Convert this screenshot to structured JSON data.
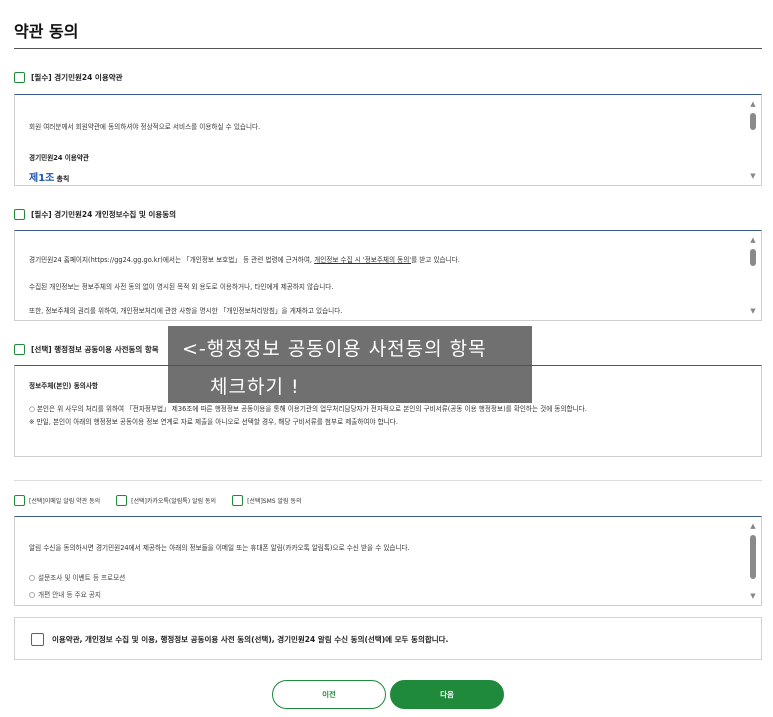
{
  "page": {
    "title": "약관 동의"
  },
  "section1": {
    "label": "[필수] 경기민원24 이용약관",
    "intro": "회원 여러분께서 회원약관에 동의하셔야 정상적으로 서비스를 이용하실 수 있습니다.",
    "heading": "경기민원24 이용약관",
    "article_num": "제1조",
    "article_title": "총칙"
  },
  "section2": {
    "label": "[필수] 경기민원24 개인정보수집 및 이용동의",
    "line1_a": "경기민원24 홈페이지(https://gg24.gg.go.kr)에서는 「개인정보 보호법」 등 관련 법령에 근거하여, ",
    "line1_b": "개인정보 수집 시 '정보주체의 동의'",
    "line1_c": "를 받고 있습니다.",
    "line2": "수집된 개인정보는 정보주체의 사전 동의 없이 명시된 목적 외 용도로 이용하거나, 타인에게 제공하지 않습니다.",
    "line3": "또한, 정보주체의 권리를 위하여, 개인정보처리에 관한 사항을 명시한 「개인정보처리방침」을 게재하고 있습니다."
  },
  "section3": {
    "label": "[선택] 행정정보 공동이용 사전동의 항목",
    "heading": "정보주체(본인) 동의사항",
    "line1": "○ 본인은 위 사무의 처리를 위하여 「전자정부법」 제36조에 따른 행정정보 공동이용을 통해 이용기관의 업무처리담당자가 전자적으로 본인의 구비서류(공동 이용 행정정보)를 확인하는 것에 동의합니다.",
    "line2": "※ 만일, 본인이 아래의 행정정보 공동이용 정보 연계로 자료 제출을 아니오로 선택할 경우, 해당 구비서류를 첨부로 제출하여야 합니다."
  },
  "annotation": {
    "line1": "<-행정정보 공동이용 사전동의 항목",
    "line2": "체크하기 !"
  },
  "options": [
    {
      "label": "[선택]이메일 알림 약관 동의"
    },
    {
      "label": "[선택]카카오톡(알림톡) 알림 동의"
    },
    {
      "label": "[선택]SMS 알림 동의"
    }
  ],
  "section4": {
    "intro": "알림 수신을 동의하시면 경기민원24에서 제공하는 아래의 정보들을 이메일 또는 휴대폰 알림(카카오톡 알림톡)으로 수신 받을 수 있습니다.",
    "items": [
      "설문조사 및 이벤트 등 프로모션",
      "개편 안내 등 주요 공지"
    ]
  },
  "agree_all": {
    "label": "이용약관, 개인정보 수집 및 이용, 행정정보 공동이용 사전 동의(선택), 경기민원24 알림 수신 동의(선택)에 모두 동의합니다."
  },
  "buttons": {
    "prev": "이전",
    "next": "다음"
  },
  "colors": {
    "accent": "#1f8a3c",
    "link_blue": "#1a55b0",
    "box_top_border": "#3a5a8c"
  }
}
